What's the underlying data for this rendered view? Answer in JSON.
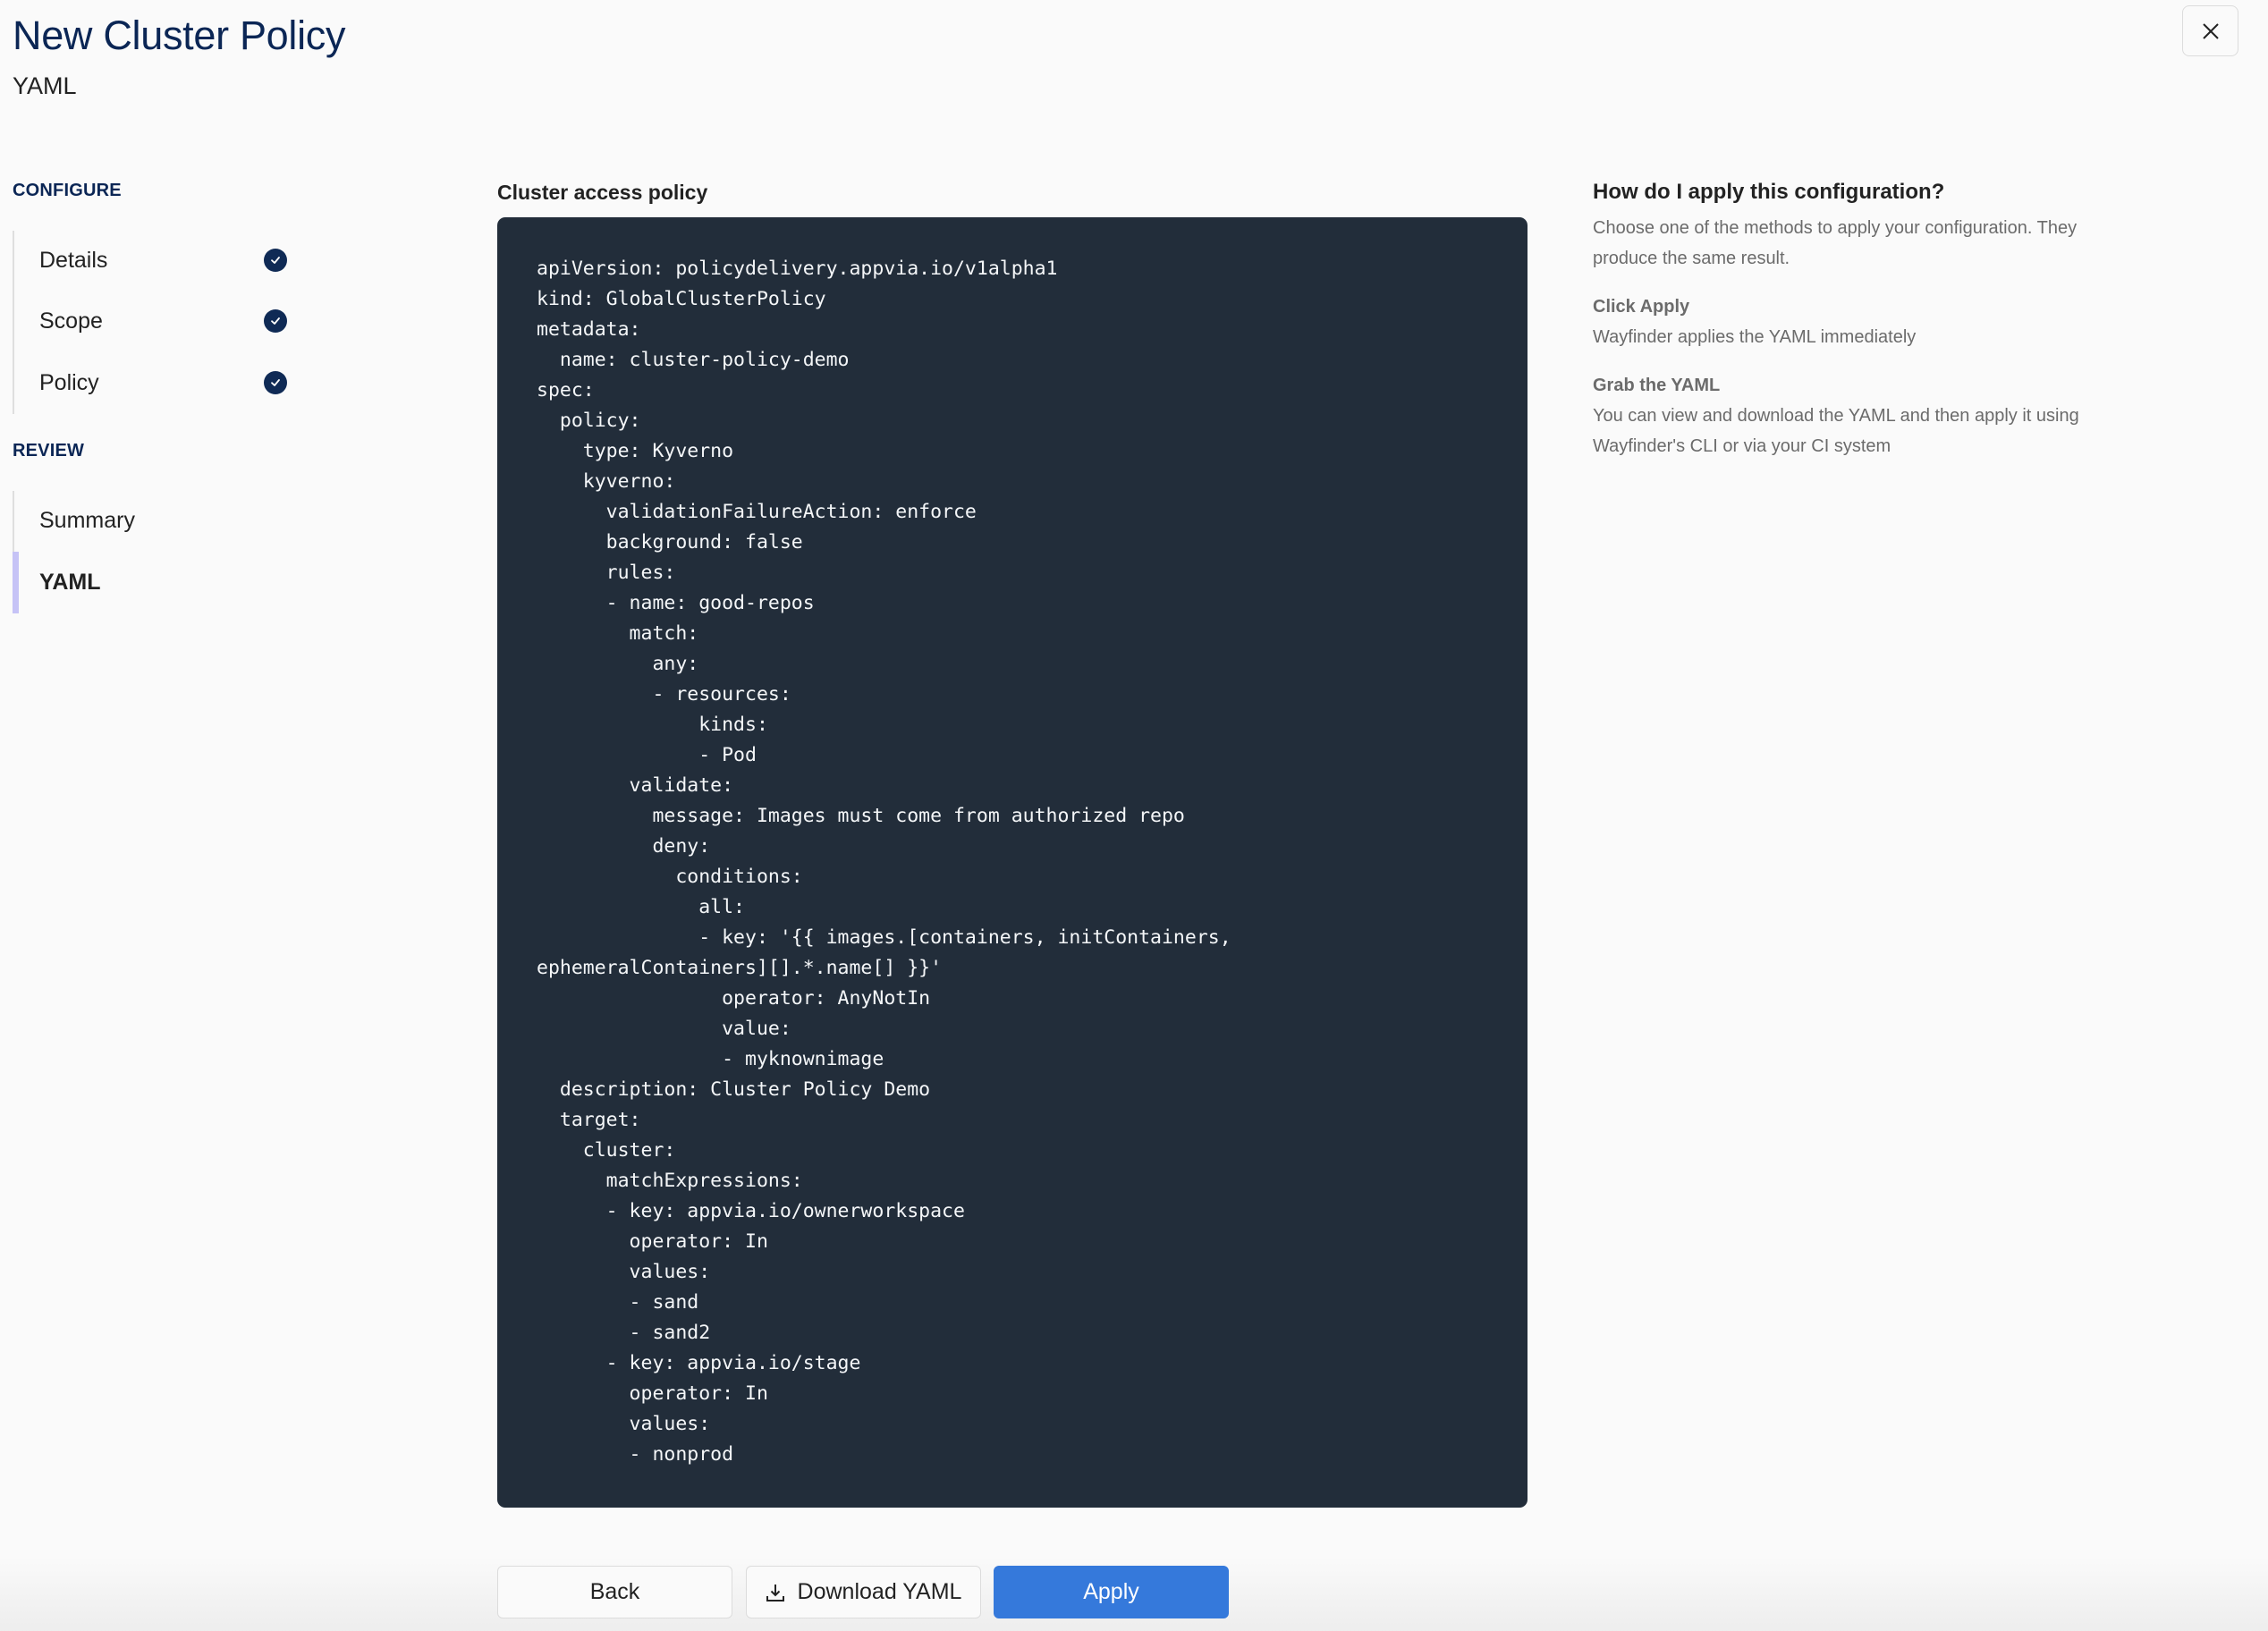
{
  "header": {
    "title": "New Cluster Policy",
    "subtitle": "YAML",
    "close_icon": "close-icon"
  },
  "sidebar": {
    "sections": [
      {
        "label": "CONFIGURE",
        "items": [
          {
            "label": "Details",
            "completed": true
          },
          {
            "label": "Scope",
            "completed": true
          },
          {
            "label": "Policy",
            "completed": true
          }
        ]
      },
      {
        "label": "REVIEW",
        "items": [
          {
            "label": "Summary",
            "completed": false
          },
          {
            "label": "YAML",
            "completed": false,
            "active": true
          }
        ]
      }
    ],
    "check_icon": "check-circle-icon",
    "active_indicator_color": "#c6c3f6"
  },
  "main": {
    "code_label": "Cluster access policy",
    "code_lines": [
      "apiVersion: policydelivery.appvia.io/v1alpha1",
      "kind: GlobalClusterPolicy",
      "metadata:",
      "  name: cluster-policy-demo",
      "spec:",
      "  policy:",
      "    type: Kyverno",
      "    kyverno:",
      "      validationFailureAction: enforce",
      "      background: false",
      "      rules:",
      "      - name: good-repos",
      "        match:",
      "          any:",
      "          - resources:",
      "              kinds:",
      "              - Pod",
      "        validate:",
      "          message: Images must come from authorized repo",
      "          deny:",
      "            conditions:",
      "              all:",
      "              - key: '{{ images.[containers, initContainers,",
      "ephemeralContainers][].*.name[] }}'",
      "                operator: AnyNotIn",
      "                value:",
      "                - myknownimage",
      "  description: Cluster Policy Demo",
      "  target:",
      "    cluster:",
      "      matchExpressions:",
      "      - key: appvia.io/ownerworkspace",
      "        operator: In",
      "        values:",
      "        - sand",
      "        - sand2",
      "      - key: appvia.io/stage",
      "        operator: In",
      "        values:",
      "        - nonprod"
    ]
  },
  "help": {
    "title": "How do I apply this configuration?",
    "intro": "Choose one of the methods to apply your configuration. They produce the same result.",
    "methods": [
      {
        "title": "Click Apply",
        "description": "Wayfinder applies the YAML immediately"
      },
      {
        "title": "Grab the YAML",
        "description": "You can view and download the YAML and then apply it using Wayfinder's CLI or via your CI system"
      }
    ]
  },
  "actions": {
    "back_label": "Back",
    "download_label": "Download YAML",
    "download_icon": "download-icon",
    "apply_label": "Apply",
    "primary_color": "#3579db"
  }
}
